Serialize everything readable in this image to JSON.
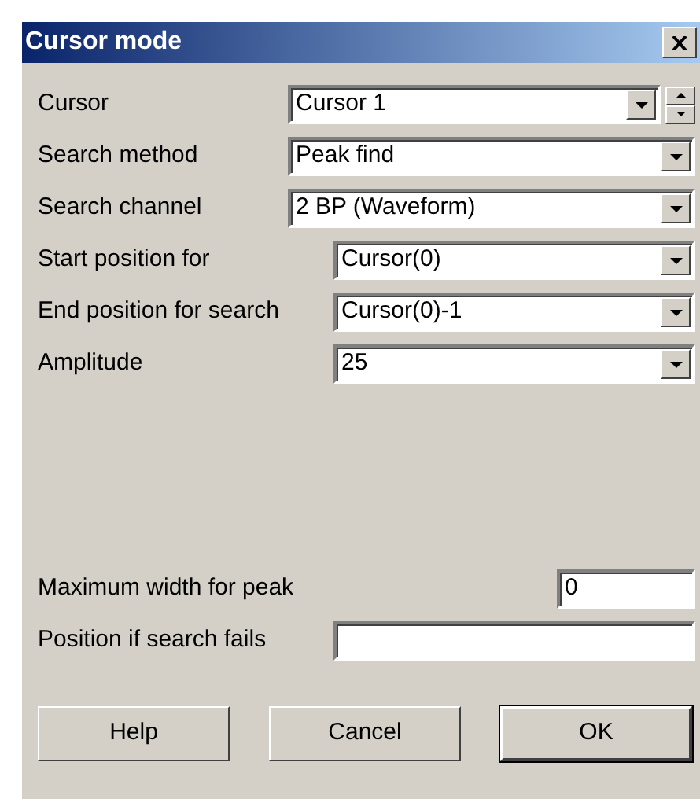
{
  "window": {
    "title": "Cursor mode"
  },
  "rows": [
    {
      "label": "Cursor",
      "kind": "combo-spin",
      "value": "Cursor 1"
    },
    {
      "label": "Search method",
      "kind": "combo",
      "value": "Peak find"
    },
    {
      "label": "Search channel",
      "kind": "combo",
      "value": "2 BP (Waveform)"
    },
    {
      "label": "Start position for",
      "kind": "combo",
      "value": "Cursor(0)"
    },
    {
      "label": "End position for search",
      "kind": "combo",
      "value": "Cursor(0)-1"
    },
    {
      "label": "Amplitude",
      "kind": "combo",
      "value": "25"
    },
    {
      "label": "Maximum width for peak",
      "kind": "short-text",
      "value": "0"
    },
    {
      "label": "Position if search fails",
      "kind": "text",
      "value": ""
    }
  ],
  "buttons": [
    {
      "label": "Help",
      "default": false
    },
    {
      "label": "Cancel",
      "default": false
    },
    {
      "label": "OK",
      "default": true
    }
  ]
}
